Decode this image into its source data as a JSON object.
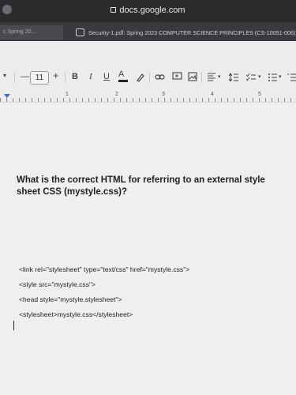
{
  "browser": {
    "url": "docs.google.com",
    "tabs": [
      {
        "label": "c Spring 20..."
      },
      {
        "label": "Security-1.pdf: Spring 2023 COMPUTER SCIENCE PRINCIPLES (CS-10051-006)"
      }
    ]
  },
  "toolbar": {
    "font_size": "11",
    "minus": "—",
    "plus": "+",
    "bold": "B",
    "italic": "I",
    "underline": "U",
    "text_color": "A",
    "chevron": "▾",
    "icons": [
      "highlight-icon",
      "link-icon",
      "comment-icon",
      "image-icon",
      "align-icon",
      "line-spacing-icon",
      "checklist-icon",
      "bullet-list-icon",
      "numbered-list-icon"
    ]
  },
  "ruler": {
    "numbers": [
      "1",
      "2",
      "3",
      "4",
      "5"
    ]
  },
  "document": {
    "question": "What is the correct HTML for referring to an external style sheet CSS (mystyle.css)?",
    "options": [
      "<link rel=\"stylesheet\" type=\"text/css\" href=\"mystyle.css\">",
      "<style src=\"mystyle.css\">",
      "<head style=\"mystyle.stylesheet\">",
      "<stylesheet>mystyle.css</stylesheet>"
    ]
  },
  "colors": {
    "ruler_marker": "#3b6fd6",
    "page": "#efefef"
  }
}
